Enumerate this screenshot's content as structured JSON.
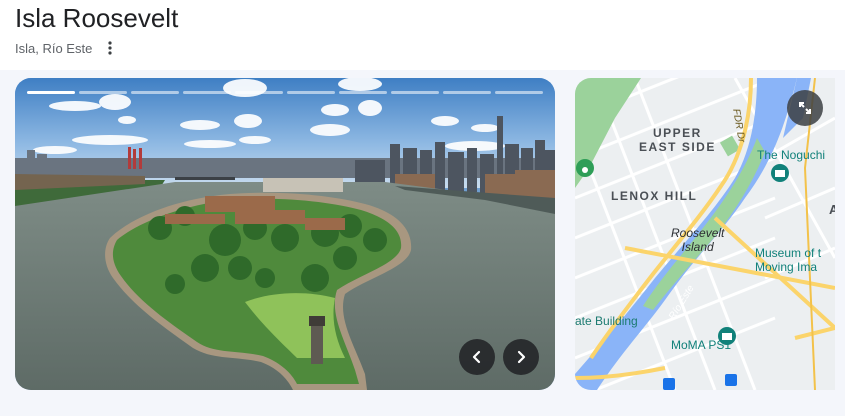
{
  "place": {
    "title": "Isla Roosevelt",
    "subtitle": "Isla, Río Este",
    "more_icon": "more-vert-icon"
  },
  "photo_gallery": {
    "segments_total": 10,
    "active_segment": 1,
    "prev_icon": "chevron-left-icon",
    "next_icon": "chevron-right-icon"
  },
  "map": {
    "expand_icon": "expand-icon",
    "labels": {
      "upper_east_side_1": "UPPER",
      "upper_east_side_2": "EAST SIDE",
      "lenox_hill": "LENOX HILL",
      "roosevelt_1": "Roosevelt",
      "roosevelt_2": "Island",
      "noguchi": "The Noguchi",
      "museum_1": "Museum of t",
      "museum_2": "Moving Ima",
      "state_building": "ate Building",
      "moma": "MoMA PS1",
      "rio_este": "Río Este",
      "fdr": "FDR Dr",
      "edge_a": "A"
    },
    "colors": {
      "water": "#8ab4f8",
      "park": "#9bd29b",
      "highway": "#fbd46b",
      "poi": "#11817a"
    }
  }
}
